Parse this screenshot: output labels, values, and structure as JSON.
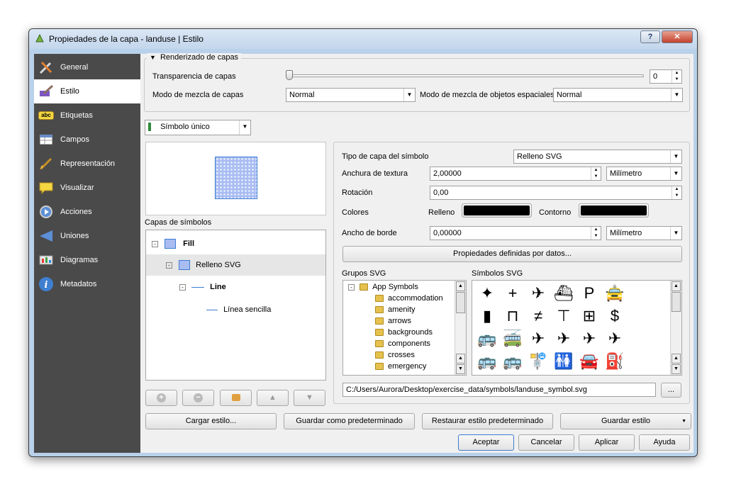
{
  "window": {
    "title": "Propiedades de la capa - landuse | Estilo",
    "help_label": "?",
    "close_label": "✕"
  },
  "sidebar": {
    "items": [
      {
        "label": "General",
        "icon": "general-icon"
      },
      {
        "label": "Estilo",
        "icon": "style-icon"
      },
      {
        "label": "Etiquetas",
        "icon": "labels-icon"
      },
      {
        "label": "Campos",
        "icon": "fields-icon"
      },
      {
        "label": "Representación",
        "icon": "rendering-icon"
      },
      {
        "label": "Visualizar",
        "icon": "display-icon"
      },
      {
        "label": "Acciones",
        "icon": "actions-icon"
      },
      {
        "label": "Uniones",
        "icon": "joins-icon"
      },
      {
        "label": "Diagramas",
        "icon": "diagrams-icon"
      },
      {
        "label": "Metadatos",
        "icon": "metadata-icon"
      }
    ],
    "etiquetas_badge": "abc"
  },
  "render": {
    "group_title": "Renderizado de capas",
    "transparency_label": "Transparencia de capas",
    "transparency_value": "0",
    "blend_label": "Modo de mezcla de capas",
    "blend_value": "Normal",
    "feature_blend_label": "Modo de mezcla de objetos espaciales",
    "feature_blend_value": "Normal"
  },
  "renderer": {
    "value": "Símbolo único"
  },
  "symbol_layers": {
    "title": "Capas de símbolos",
    "tree": {
      "fill": "Fill",
      "svg_fill": "Relleno SVG",
      "line": "Line",
      "simple_line": "Línea sencilla"
    }
  },
  "props": {
    "layer_type_label": "Tipo de capa del símbolo",
    "layer_type_value": "Relleno SVG",
    "texture_width_label": "Anchura de textura",
    "texture_width_value": "2,00000",
    "texture_unit": "Milímetro",
    "rotation_label": "Rotación",
    "rotation_value": "0,00",
    "colors_label": "Colores",
    "fill_label": "Relleno",
    "outline_label": "Contorno",
    "fill_color": "#000000",
    "outline_color": "#000000",
    "border_width_label": "Ancho de borde",
    "border_width_value": "0,00000",
    "border_unit": "Milímetro",
    "data_defined_button": "Propiedades definidas por datos..."
  },
  "svg_groups": {
    "title": "Grupos SVG",
    "root": "App Symbols",
    "items": [
      "accommodation",
      "amenity",
      "arrows",
      "backgrounds",
      "components",
      "crosses",
      "emergency"
    ]
  },
  "svg_symbols": {
    "title": "Símbolos SVG",
    "symbols": [
      "✦",
      "+",
      "✈",
      "⛴",
      "P",
      "🚖",
      "▮",
      "⊓",
      "≠",
      "⊤",
      "⊞",
      "$",
      "🚌",
      "🚎",
      "✈",
      "✈",
      "✈",
      "✈",
      "🚌",
      "🚌",
      "🚏",
      "🚻",
      "🚘",
      "⛽"
    ]
  },
  "svg_path": {
    "value": "C:/Users/Aurora/Desktop/exercise_data/symbols/landuse_symbol.svg",
    "browse_label": "..."
  },
  "bottom": {
    "load_style": "Cargar estilo...",
    "save_default": "Guardar como predeterminado",
    "restore_default": "Restaurar estilo predeterminado",
    "save_style": "Guardar estilo",
    "ok": "Aceptar",
    "cancel": "Cancelar",
    "apply": "Aplicar",
    "help": "Ayuda"
  }
}
